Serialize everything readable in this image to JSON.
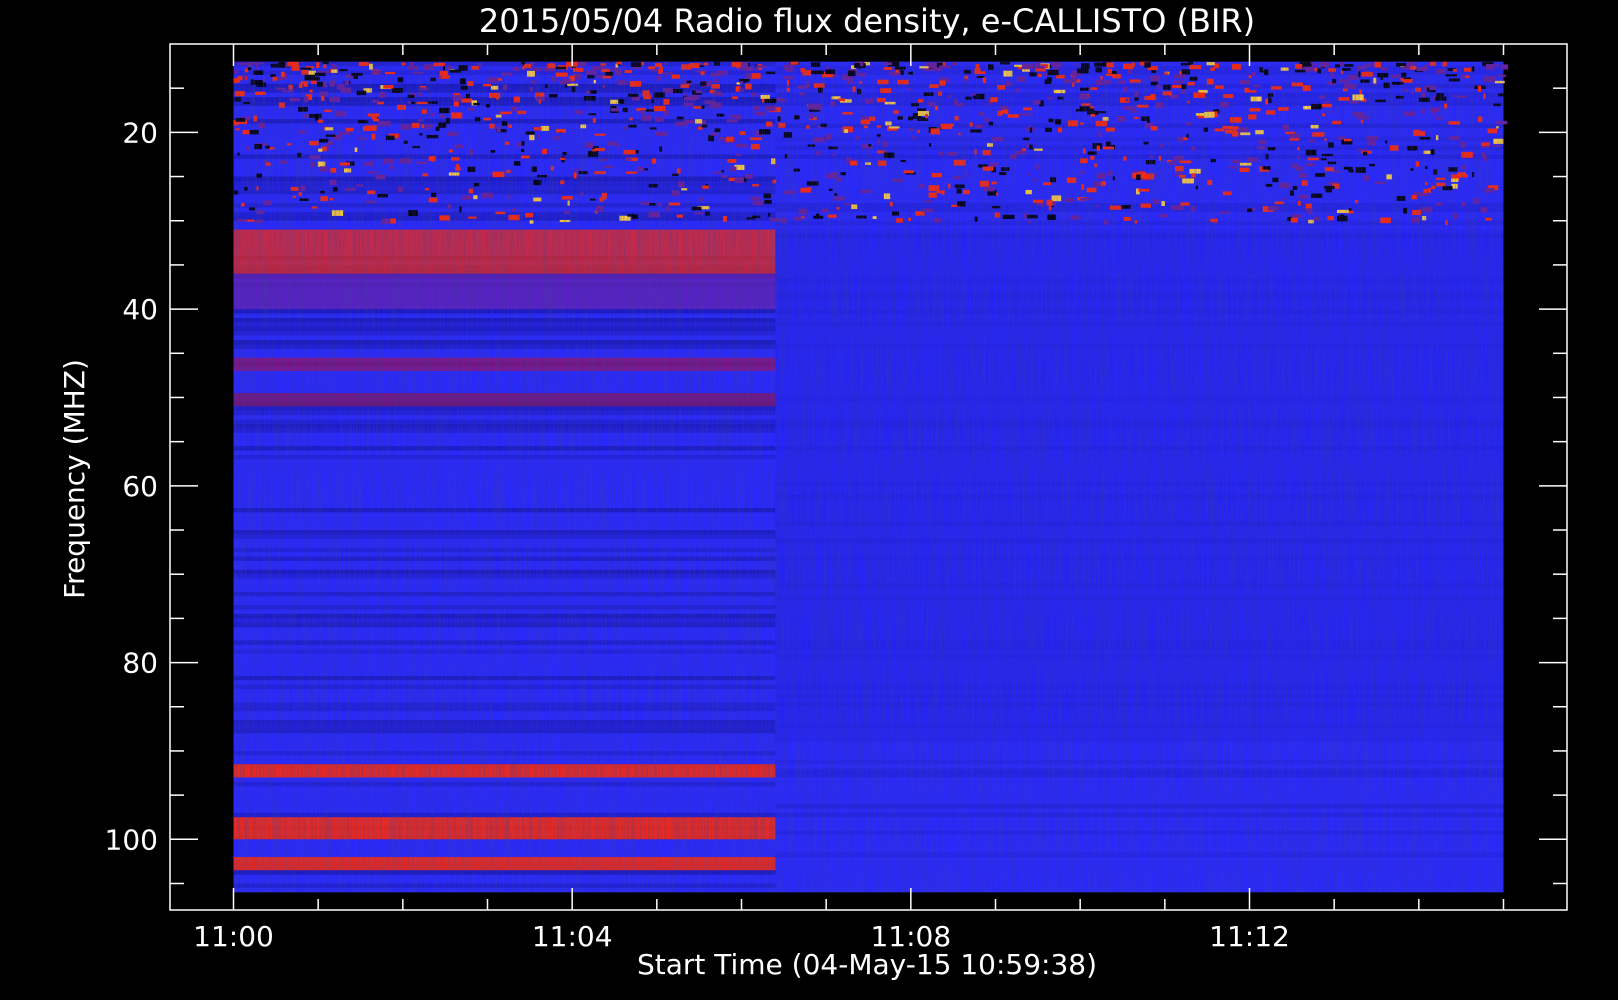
{
  "chart_data": {
    "type": "heatmap",
    "title": "2015/05/04  Radio flux density, e-CALLISTO (BIR)",
    "xlabel": "Start Time (04-May-15 10:59:38)",
    "ylabel": "Frequency (MHZ)",
    "x_ticks": [
      "11:00",
      "11:04",
      "11:08",
      "11:12"
    ],
    "x_tick_minutes": [
      0,
      4,
      8,
      12
    ],
    "xlim_minutes": [
      -0.75,
      15.75
    ],
    "data_x_range_minutes": [
      0,
      15
    ],
    "y_ticks": [
      20,
      40,
      60,
      80,
      100
    ],
    "ylim": [
      10,
      108
    ],
    "data_y_range": [
      12,
      106
    ],
    "y_inverted": true,
    "grid": false,
    "colors": {
      "background": "#000000",
      "low": "#1414d8",
      "mid": "#2828ff",
      "high": "#ff2a0a",
      "peak": "#ffd040"
    },
    "features": {
      "instrument_change_minute": 6.4,
      "bright_bands_early_mhz": [
        [
          31,
          36
        ],
        [
          91.5,
          93
        ],
        [
          97.5,
          100
        ],
        [
          102,
          103.5
        ]
      ],
      "interference_band_mhz": [
        12,
        30
      ]
    }
  }
}
